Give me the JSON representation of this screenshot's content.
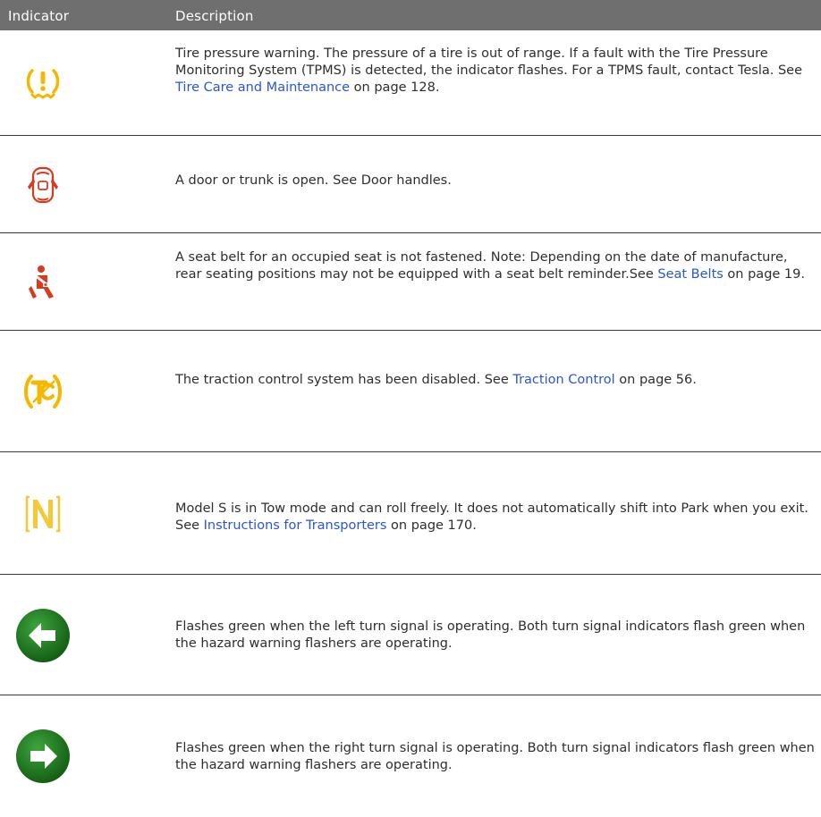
{
  "header": {
    "indicator": "Indicator",
    "description": "Description"
  },
  "colors": {
    "header_bg": "#6f6f6f",
    "link": "#2a55d8",
    "amber": "#f5b800",
    "red": "#d83a1e",
    "green": "#1e7a1e"
  },
  "rows": [
    {
      "icon": "tire-pressure-warning-icon",
      "text_before": "Tire pressure warning. The pressure of a tire is out of range. If a fault with the Tire Pressure Monitoring System (TPMS) is detected, the indicator flashes. For a TPMS fault, contact Tesla. See ",
      "link": "Tire Care and Maintenance",
      "text_after": " on page 128."
    },
    {
      "icon": "door-open-icon",
      "text_before": "A door or trunk is open. See Door handles.",
      "link": "",
      "text_after": ""
    },
    {
      "icon": "seat-belt-icon",
      "text_before": "A seat belt for an occupied seat is not fastened. Note: Depending on the date of manufacture, rear seating positions may not be equipped with a seat belt reminder.See ",
      "link": "Seat Belts",
      "text_after": " on page 19."
    },
    {
      "icon": "traction-control-off-icon",
      "text_before": "The traction control system has been disabled. See ",
      "link": "Traction Control",
      "text_after": " on page 56."
    },
    {
      "icon": "tow-mode-icon",
      "text_before": "Model S is in Tow mode and can roll freely. It does not automatically shift into Park when you exit. See ",
      "link": "Instructions for Transporters",
      "text_after": " on page 170."
    },
    {
      "icon": "left-turn-signal-icon",
      "text_before": "Flashes green when the left turn signal is operating. Both turn signal indicators flash green when the hazard warning flashers are operating.",
      "link": "",
      "text_after": ""
    },
    {
      "icon": "right-turn-signal-icon",
      "text_before": "Flashes green when the right turn signal is operating. Both turn signal indicators flash green when the hazard warning flashers are operating.",
      "link": "",
      "text_after": ""
    }
  ]
}
